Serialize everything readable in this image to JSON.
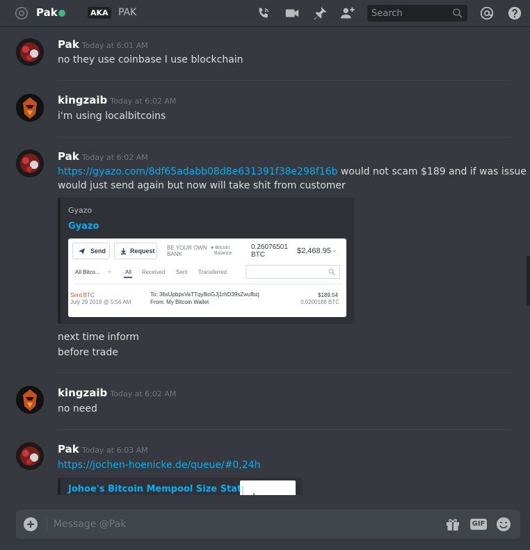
{
  "header": {
    "channel_name": "Pak",
    "aka_label": "AKA",
    "nickname": "PAK",
    "search_placeholder": "Search",
    "status_color": "#43b581",
    "icons": [
      "at-icon",
      "phone-call-icon",
      "video-call-icon",
      "pin-icon",
      "add-friend-icon",
      "search-icon",
      "mention-icon",
      "help-icon"
    ]
  },
  "messages": [
    {
      "author": "Pak",
      "timestamp": "Today at 6:01 AM",
      "lines": [
        "no they use coinbase I use blockchain"
      ]
    },
    {
      "author": "kingzaib",
      "timestamp": "Today at 6:02 AM",
      "lines": [
        "i'm using localbitcoins"
      ]
    },
    {
      "author": "Pak",
      "timestamp": "Today at 6:02 AM",
      "link": "https://gyazo.com/8df65adabb08d8e631391f38e298f16b",
      "link_trailing": " would not scam $189 and if was issue",
      "line2": "would just send again but now will take shit from customer",
      "embed": {
        "provider": "Gyazo",
        "title": "Gyazo",
        "shot": {
          "send": "Send",
          "request": "Request",
          "bank_1": "BE YOUR OWN",
          "bank_2": "BANK",
          "balance_label_1": "Bitcoin",
          "balance_label_2": "Balance",
          "btc_1": "0.26076501",
          "btc_2": "BTC",
          "usd": "$2,468.95",
          "filter": "All Bitco...",
          "tab_all": "All",
          "tab_received": "Received",
          "tab_sent": "Sent",
          "tab_transferred": "Transferred",
          "tx_type": "Sent BTC",
          "tx_date": "July 29 2019 @ 5:56 AM",
          "tx_to": "To: 36sUpbpsVaTTqy8ioGJj1rhD39sZwufbzj",
          "tx_from": "From: My Bitcoin Wallet",
          "tx_usd": "$189.54",
          "tx_btc": "0.0200188 BTC"
        }
      },
      "after": [
        "next time inform",
        "before trade"
      ]
    },
    {
      "author": "kingzaib",
      "timestamp": "Today at 6:02 AM",
      "lines": [
        "no need"
      ]
    },
    {
      "author": "Pak",
      "timestamp": "Today at 6:03 AM",
      "link": "https://jochen-hoenicke.de/queue/#0,24h",
      "embed": {
        "title": "Johoe's Bitcoin Mempool Size Statistics"
      }
    }
  ],
  "composer": {
    "placeholder": "Message @Pak",
    "gif_label": "GIF",
    "icons": [
      "plus-icon",
      "gift-icon",
      "gif-icon",
      "emoji-icon"
    ]
  },
  "colors": {
    "background": "#36393f",
    "link": "#00b0f4",
    "embed": "#2f3136",
    "composer": "#40444b"
  }
}
